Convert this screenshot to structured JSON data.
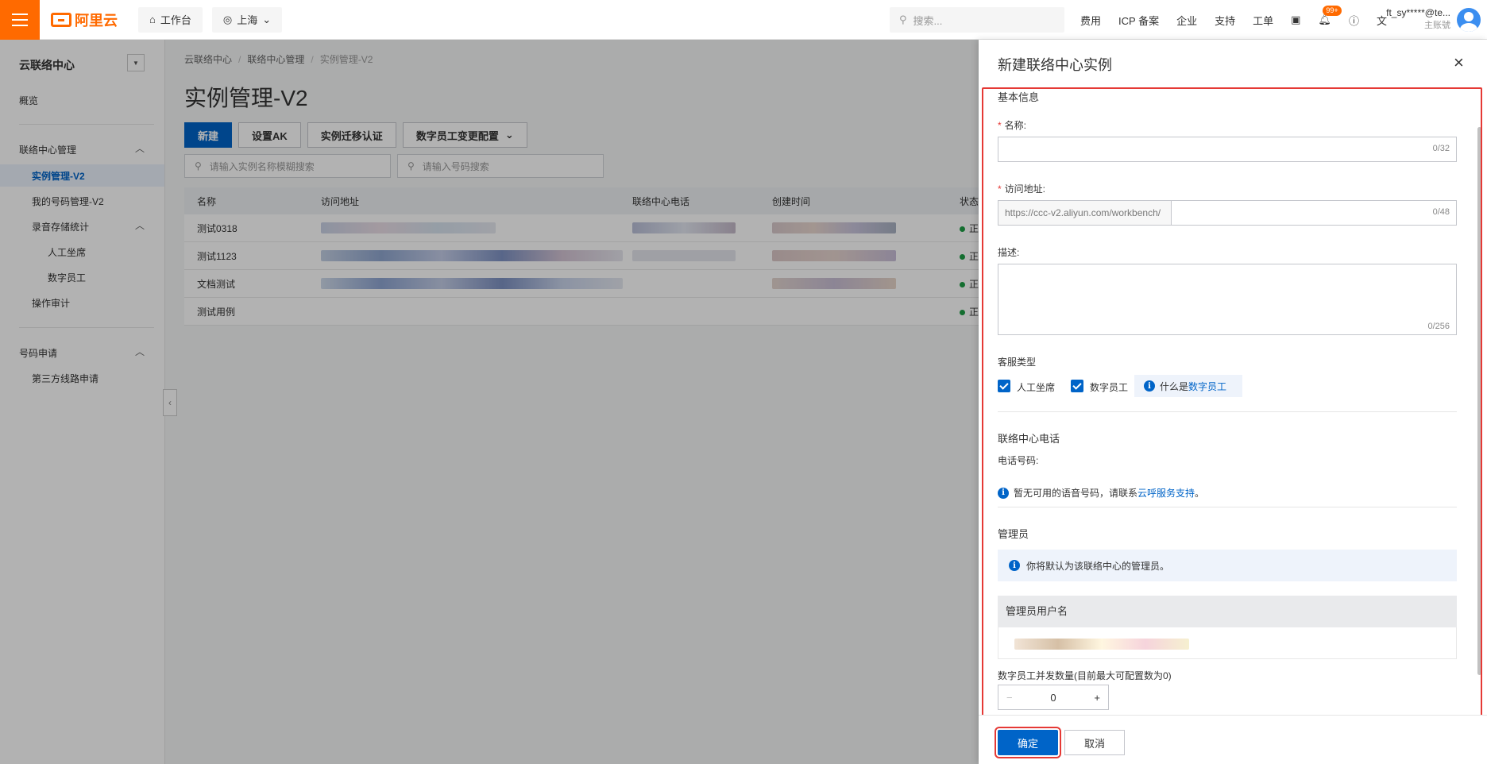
{
  "topbar": {
    "brand": "阿里云",
    "workbench": "工作台",
    "region": "上海",
    "search_placeholder": "搜索...",
    "links": [
      "费用",
      "ICP 备案",
      "企业",
      "支持",
      "工单"
    ],
    "notification_count": "99+",
    "user_name": "ft_sy*****@te...",
    "user_role": "主账號"
  },
  "sidebar": {
    "title": "云联络中心",
    "overview": "概览",
    "group_contact_center": "联络中心管理",
    "instance_mgmt": "实例管理-V2",
    "my_numbers": "我的号码管理-V2",
    "recording_stats": "录音存储统计",
    "human_agent": "人工坐席",
    "digital_employee": "数字员工",
    "audit": "操作审计",
    "group_number": "号码申请",
    "third_party": "第三方线路申请"
  },
  "main": {
    "breadcrumb": [
      "云联络中心",
      "联络中心管理",
      "实例管理-V2"
    ],
    "title": "实例管理-V2",
    "buttons": {
      "new": "新建",
      "set_ak": "设置AK",
      "migrate": "实例迁移认证",
      "digital_config": "数字员工变更配置"
    },
    "search_instance_placeholder": "请输入实例名称模糊搜索",
    "search_number_placeholder": "请输入号码搜索",
    "table": {
      "columns": [
        "名称",
        "访问地址",
        "联络中心电话",
        "创建时间",
        "状态"
      ],
      "rows": [
        {
          "name": "测试0318",
          "status": "正"
        },
        {
          "name": "测试1123",
          "status": "正"
        },
        {
          "name": "文档测试",
          "status": "正"
        },
        {
          "name": "测试用例",
          "status": "正"
        }
      ]
    }
  },
  "drawer": {
    "title": "新建联络中心实例",
    "basic_info": "基本信息",
    "name_label": "名称:",
    "name_counter": "0/32",
    "url_label": "访问地址:",
    "url_prefix": "https://ccc-v2.aliyun.com/workbench/",
    "url_counter": "0/48",
    "desc_label": "描述:",
    "desc_counter": "0/256",
    "service_type_label": "客服类型",
    "human_agent": "人工坐席",
    "digital_employee": "数字员工",
    "what_is_prefix": "什么是",
    "what_is_link": "数字员工",
    "phone_section": "联络中心电话",
    "phone_label": "电话号码:",
    "no_number_text": "暂无可用的语音号码，请联系",
    "no_number_link": "云呼服务支持",
    "no_number_suffix": "。",
    "admin_section": "管理员",
    "admin_info": "你将默认为该联络中心的管理员。",
    "admin_col": "管理员用户名",
    "concurrency_label": "数字员工并发数量(目前最大可配置数为0)",
    "concurrency_value": "0",
    "ok": "确定",
    "cancel": "取消"
  },
  "colors": {
    "brand": "#ff6a00",
    "primary": "#0064c8",
    "highlight": "#e53935"
  }
}
